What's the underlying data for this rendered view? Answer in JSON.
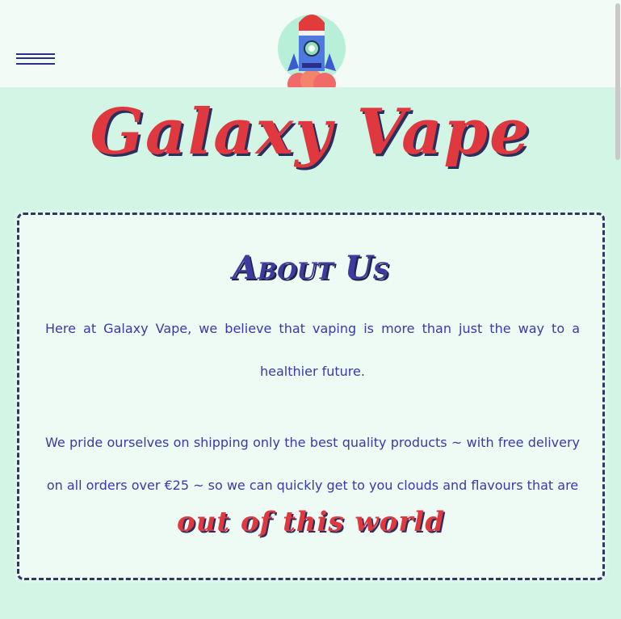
{
  "header": {
    "menu_icon": "hamburger-menu-icon",
    "logo_icon": "rocket-logo-icon"
  },
  "site": {
    "title": "Galaxy Vape"
  },
  "about": {
    "title": "About Us",
    "paragraph_1": "Here at Galaxy Vape, we believe that vaping is more than just the way to a healthier future.",
    "paragraph_2": "We pride ourselves on shipping only the best quality products ~ with free delivery on all orders over €25 ~ so we can quickly get to you clouds and flavours that are",
    "tagline": "out of this world"
  },
  "colors": {
    "background": "#d3f5e6",
    "header": "#f3fbf7",
    "accent_red": "#e0383f",
    "text_blue": "#3a3aa8",
    "border": "#2d3a5f"
  }
}
